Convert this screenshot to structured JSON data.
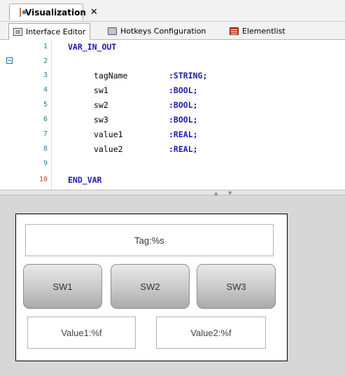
{
  "document_tab": {
    "title": "Visualization",
    "close_glyph": "✕"
  },
  "sub_tabs": [
    {
      "label": "Interface Editor",
      "icon": "interface-editor-icon"
    },
    {
      "label": "Hotkeys Configuration",
      "icon": "keyboard-icon"
    },
    {
      "label": "Elementlist",
      "icon": "elementlist-icon"
    }
  ],
  "editor": {
    "line_numbers": [
      "1",
      "2",
      "3",
      "4",
      "5",
      "6",
      "7",
      "8",
      "9",
      "10"
    ],
    "lines": [
      {
        "keyword": "VAR_IN_OUT"
      },
      {
        "keyword": ""
      },
      {
        "name": "tagName",
        "type": ":STRING;"
      },
      {
        "name": "sw1",
        "type": ":BOOL;"
      },
      {
        "name": "sw2",
        "type": ":BOOL;"
      },
      {
        "name": "sw3",
        "type": ":BOOL;"
      },
      {
        "name": "value1",
        "type": ":REAL;"
      },
      {
        "name": "value2",
        "type": ":REAL;"
      },
      {
        "keyword": ""
      },
      {
        "keyword": "END_VAR"
      }
    ]
  },
  "visualization": {
    "tag_label": "Tag:%s",
    "buttons": [
      "SW1",
      "SW2",
      "SW3"
    ],
    "value1_label": "Value1:%f",
    "value2_label": "Value2:%f"
  },
  "colors": {
    "keyword": "#1a1ab8",
    "line_number": "#1d7fa0",
    "current_line_number": "#c0392b"
  }
}
